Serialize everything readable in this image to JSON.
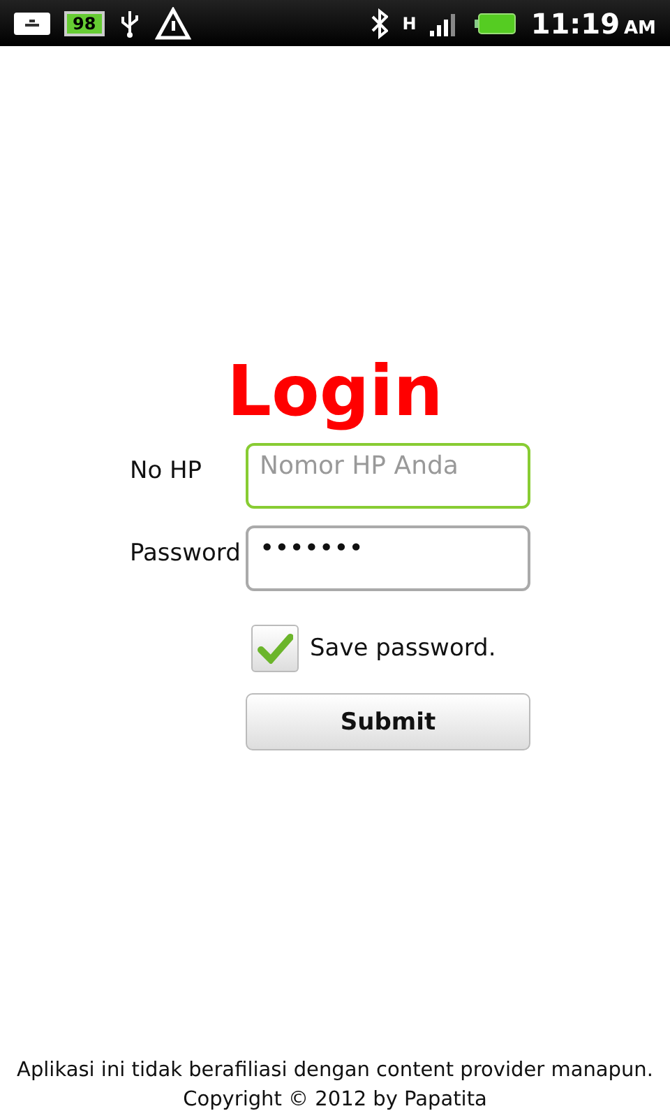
{
  "status_bar": {
    "battery_badge": "98",
    "network": "H",
    "time": "11:19",
    "am_pm": "AM"
  },
  "title": "Login",
  "fields": [
    {
      "label": "No HP",
      "placeholder": "Nomor HP Anda",
      "focused": true
    },
    {
      "label": "Password",
      "value": "•••••••",
      "focused": false
    }
  ],
  "save_password": {
    "label": "Save password.",
    "checked": true
  },
  "submit": "Submit",
  "footer": [
    "Aplikasi ini tidak berafiliasi dengan content provider manapun.",
    "Copyright © 2012 by Papatita"
  ]
}
